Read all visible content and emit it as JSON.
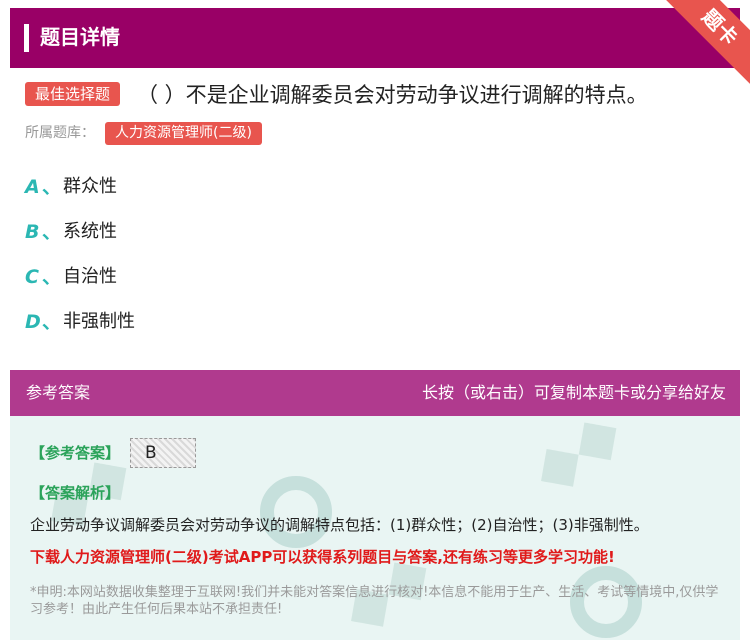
{
  "header": {
    "title": "题目详情",
    "corner_label": "题卡"
  },
  "question": {
    "type_badge": "最佳选择题",
    "text": "（ ）不是企业调解委员会对劳动争议进行调解的特点。",
    "bank_label": "所属题库：",
    "bank_name": "人力资源管理师(二级)"
  },
  "options": [
    {
      "letter": "A",
      "sep": "、",
      "text": "群众性"
    },
    {
      "letter": "B",
      "sep": "、",
      "text": "系统性"
    },
    {
      "letter": "C",
      "sep": "、",
      "text": "自治性"
    },
    {
      "letter": "D",
      "sep": "、",
      "text": "非强制性"
    }
  ],
  "answer_section": {
    "title": "参考答案",
    "hint": "长按（或右击）可复制本题卡或分享给好友",
    "ref_label": "【参考答案】",
    "ref_value": "B",
    "exp_label": "【答案解析】",
    "explanation": "企业劳动争议调解委员会对劳动争议的调解特点包括：(1)群众性；(2)自治性；(3)非强制性。",
    "promo": "下载人力资源管理师(二级)考试APP可以获得系列题目与答案,还有练习等更多学习功能!",
    "disclaimer": "*申明:本网站数据收集整理于互联网!我们并未能对答案信息进行核对!本信息不能用于生产、生活、考试等情境中,仅供学习参考！由此产生任何后果本站不承担责任!"
  },
  "colors": {
    "header_bg": "#990066",
    "answer_header_bg": "#b03a8e",
    "badge_red": "#e8554e",
    "option_letter": "#2bb7b3",
    "answer_label_green": "#2ba35a",
    "promo_red": "#e01a1a",
    "answer_body_bg": "#e9f5f3"
  }
}
